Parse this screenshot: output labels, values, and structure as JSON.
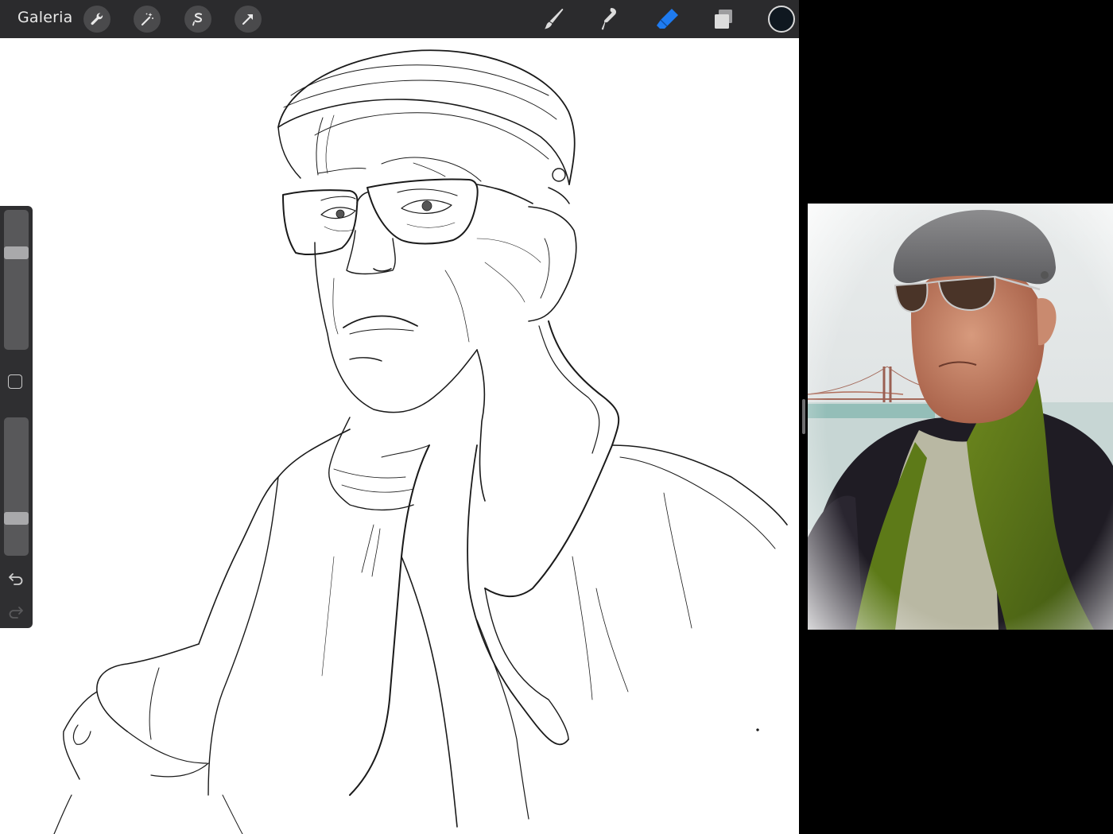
{
  "toolbar": {
    "gallery_label": "Galeria",
    "left_tools": [
      "wrench-icon",
      "magic-wand-icon",
      "selection-icon",
      "transform-arrow-icon"
    ],
    "right_tools": [
      "brush-icon",
      "smudge-icon",
      "eraser-icon",
      "layers-icon"
    ],
    "active_tool": "eraser-icon",
    "accent_color": "#1e7bf0",
    "current_color": "#0f1820"
  },
  "sidebar": {
    "brush_size_level": 0.71,
    "opacity_level": 0.25,
    "redo_enabled": false
  },
  "reference": {
    "image": "portrait-photo"
  }
}
